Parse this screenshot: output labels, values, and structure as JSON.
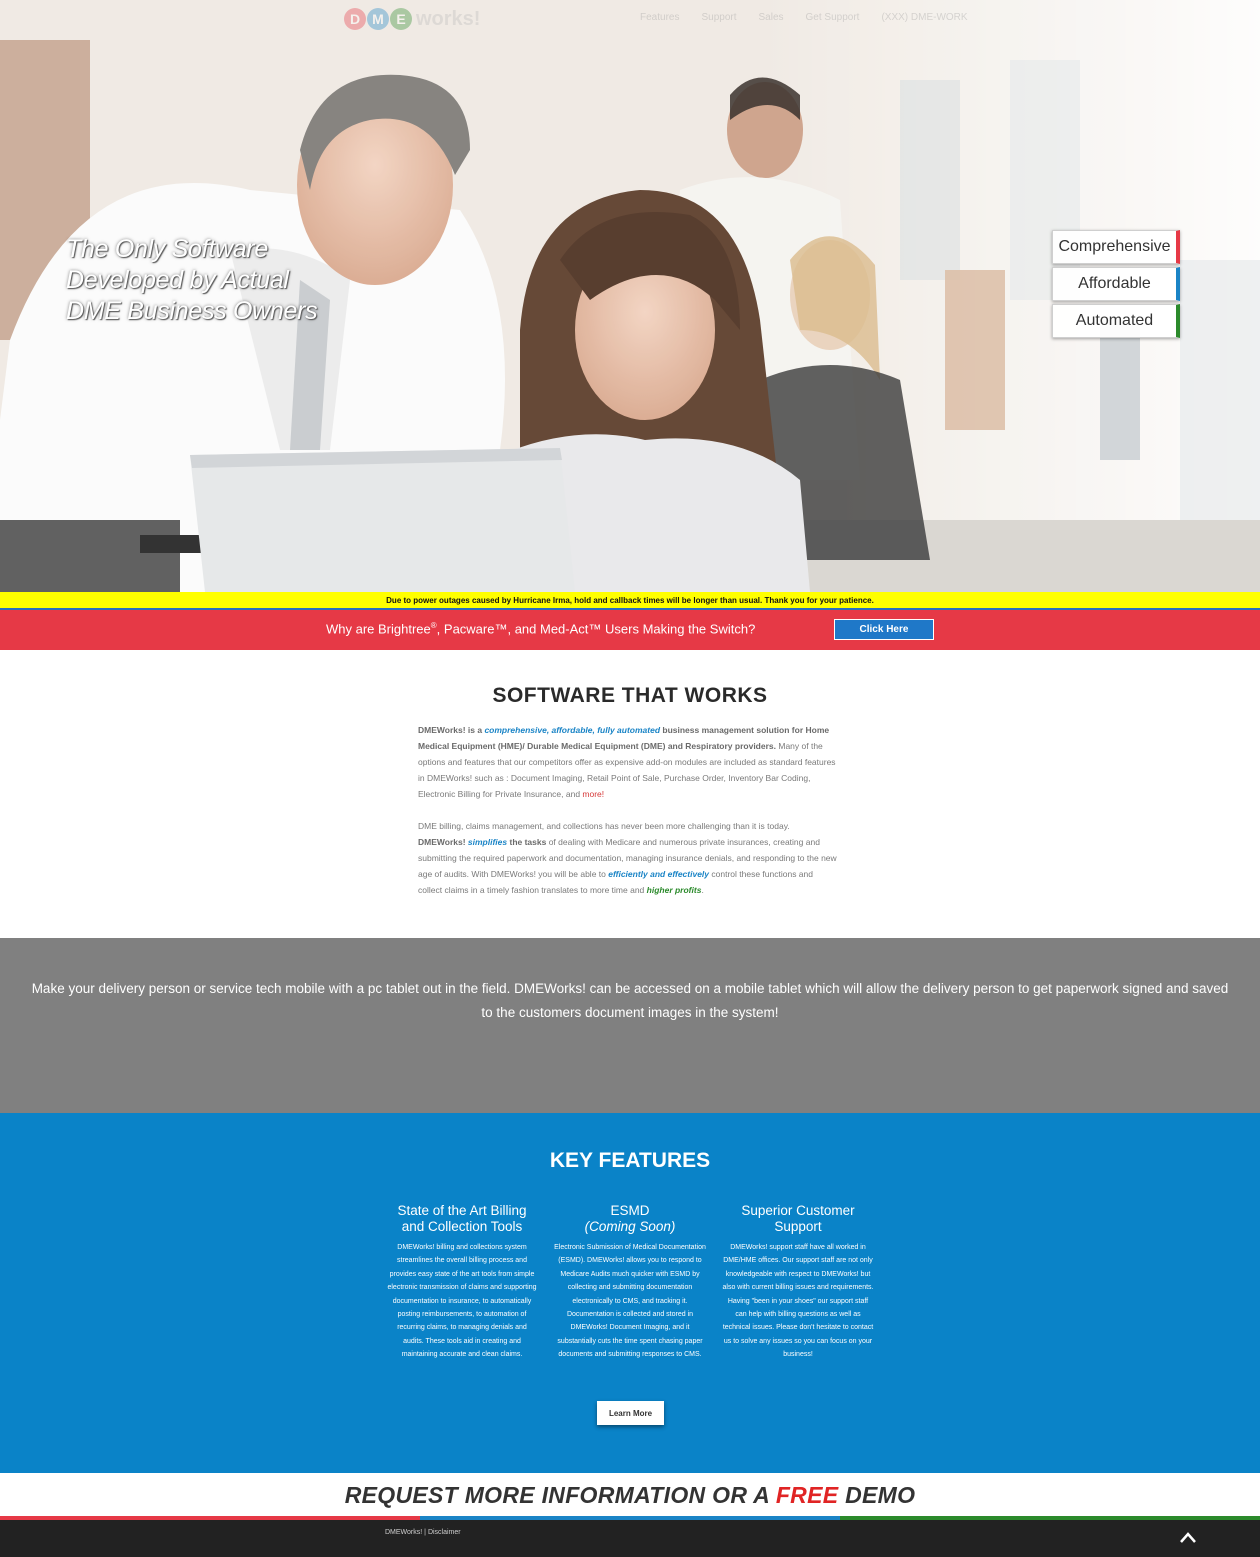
{
  "nav": {
    "logo_letters": [
      "D",
      "M",
      "E"
    ],
    "logo_word": "works!",
    "logo_colors": [
      "#e63946",
      "#1a84c6",
      "#2b8a2b"
    ],
    "links": [
      "Features",
      "Support",
      "Sales",
      "Get Support",
      "(XXX) DME-WORK"
    ]
  },
  "hero": {
    "tagline_lines": [
      "The Only Software",
      "Developed by Actual",
      "DME Business Owners"
    ],
    "pills": [
      {
        "label": "Comprehensive",
        "accent": "#e63946"
      },
      {
        "label": "Affordable",
        "accent": "#1a84c6"
      },
      {
        "label": "Automated",
        "accent": "#2b8a2b"
      }
    ]
  },
  "alert": {
    "text": "Due to power outages caused by Hurricane Irma, hold and callback times will be longer than usual. Thank you for your patience."
  },
  "switch_bar": {
    "question_1": "Why are Brightree",
    "reg": "®",
    "question_2": ", Pacware™, and Med-Act™ Users Making the Switch?",
    "button": "Click Here"
  },
  "software": {
    "title": "SOFTWARE THAT WORKS",
    "p1_brand": "DMEWorks! is a ",
    "p1_emph": "comprehensive, affordable, fully automated",
    "p1_bold": " business management solution for Home Medical Equipment (HME)/ Durable Medical Equipment (DME) and Respiratory providers.",
    "p1_rest": " Many of the options and features that our competitors offer as expensive add-on modules are included as standard features in DMEWorks! such as : Document Imaging, Retail Point of Sale, Purchase Order, Inventory Bar Coding, Electronic Billing for Private Insurance, and ",
    "p1_more": "more!",
    "p2_intro": "DME billing, claims management, and collections has never been more challenging than it is today. ",
    "p2_brand": "DMEWorks! ",
    "p2_simplifies": "simplifies",
    "p2_tasks": " the tasks",
    "p2_mid": " of dealing with Medicare and numerous private insurances, creating and submitting the required paperwork and documentation,  managing insurance denials, and responding to the new age of audits.  With DMEWorks! you will be able to ",
    "p2_eff": "efficiently and effectively",
    "p2_end": " control these functions and collect claims in a timely fashion translates to more time and ",
    "p2_profits": "higher profits",
    "p2_period": "."
  },
  "mobile": {
    "text": "Make your delivery person or service tech mobile with a pc tablet out in the field. DMEWorks! can be accessed on a mobile tablet which will allow the delivery person to get paperwork signed and saved to the customers document images in the system!"
  },
  "features": {
    "title": "KEY FEATURES",
    "items": [
      {
        "title": "State of the Art Billing and Collection Tools",
        "subtitle": "",
        "text": "DMEWorks! billing and collections system streamlines the overall billing process and provides easy state of the art tools from simple electronic transmission of claims and supporting documentation to insurance,  to automatically posting reimbursements, to automation of recurring claims, to managing denials and audits.  These tools aid in creating and maintaining accurate and clean claims."
      },
      {
        "title": "ESMD",
        "subtitle": "(Coming Soon)",
        "text": "Electronic Submission of Medical Documentation (ESMD). DMEWorks! allows you to respond to Medicare Audits much quicker with ESMD by collecting and submitting documentation electronically to CMS, and tracking it. Documentation is collected and stored in DMEWorks! Document Imaging, and it substantially cuts the time spent chasing paper documents and submitting responses to CMS."
      },
      {
        "title": "Superior Customer Support",
        "subtitle": "",
        "text": "DMEWorks! support staff have all worked in DME/HME offices. Our support staff are not only knowledgeable with respect to DMEWorks! but also with current billing issues and requirements. Having \"been in your shoes\" our support staff can help with billing questions as well as technical issues. Please don't hesitate to contact us to solve any issues so you can focus on your business!"
      }
    ],
    "button": "Learn More"
  },
  "request": {
    "pre": "REQUEST MORE INFORMATION OR A ",
    "free": "FREE",
    "post": " DEMO",
    "bar_colors": [
      "#e63946",
      "#1a84c6",
      "#2b8a2b"
    ]
  },
  "footer": {
    "brand": "DMEWorks!",
    "sep": " | ",
    "disclaimer": "Disclaimer",
    "to_top_icon": "chevron-up-icon"
  }
}
